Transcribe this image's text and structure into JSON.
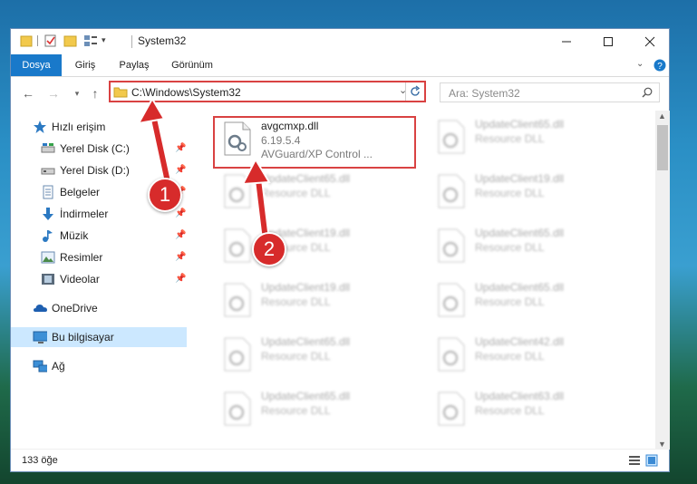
{
  "window": {
    "title": "System32",
    "title_separator": "|"
  },
  "ribbon": {
    "tabs": [
      "Dosya",
      "Giriş",
      "Paylaş",
      "Görünüm"
    ],
    "active_tab": "Dosya"
  },
  "navbar": {
    "address": "C:\\Windows\\System32",
    "search_placeholder": "Ara: System32"
  },
  "sidebar": {
    "items": [
      {
        "label": "Hızlı erişim",
        "icon": "star-icon"
      },
      {
        "label": "Yerel Disk (C:)",
        "icon": "drive-icon",
        "pinned": true
      },
      {
        "label": "Yerel Disk (D:)",
        "icon": "drive-icon",
        "pinned": true
      },
      {
        "label": "Belgeler",
        "icon": "documents-icon",
        "pinned": true
      },
      {
        "label": "İndirmeler",
        "icon": "download-icon",
        "pinned": true
      },
      {
        "label": "Müzik",
        "icon": "music-icon",
        "pinned": true
      },
      {
        "label": "Resimler",
        "icon": "pictures-icon",
        "pinned": true
      },
      {
        "label": "Videolar",
        "icon": "videos-icon",
        "pinned": true
      },
      {
        "label": "OneDrive",
        "icon": "onedrive-icon"
      },
      {
        "label": "Bu bilgisayar",
        "icon": "computer-icon",
        "selected": true
      },
      {
        "label": "Ağ",
        "icon": "network-icon"
      }
    ]
  },
  "files": {
    "highlighted": {
      "name": "avgcmxp.dll",
      "version": "6.19.5.4",
      "description": "AVGuard/XP Control ..."
    },
    "left_column": [
      {
        "name": "UpdateClient65.dll",
        "description": "Resource DLL"
      },
      {
        "name": "UpdateClient19.dll",
        "description": "Resource DLL"
      },
      {
        "name": "UpdateClient19.dll",
        "description": "Resource DLL"
      },
      {
        "name": "UpdateClient65.dll",
        "description": "Resource DLL"
      },
      {
        "name": "UpdateClient65.dll",
        "description": "Resource DLL"
      }
    ],
    "right_column": [
      {
        "name": "UpdateClient65.dll",
        "description": "Resource DLL"
      },
      {
        "name": "UpdateClient19.dll",
        "description": "Resource DLL"
      },
      {
        "name": "UpdateClient65.dll",
        "description": "Resource DLL"
      },
      {
        "name": "UpdateClient65.dll",
        "description": "Resource DLL"
      },
      {
        "name": "UpdateClient42.dll",
        "description": "Resource DLL"
      },
      {
        "name": "UpdateClient63.dll",
        "description": "Resource DLL"
      }
    ]
  },
  "status": {
    "item_count": "133 öğe"
  },
  "annotations": {
    "badge1": "1",
    "badge2": "2"
  },
  "colors": {
    "accent": "#1979ca",
    "highlight": "#d94242",
    "badge": "#d72b2b"
  }
}
